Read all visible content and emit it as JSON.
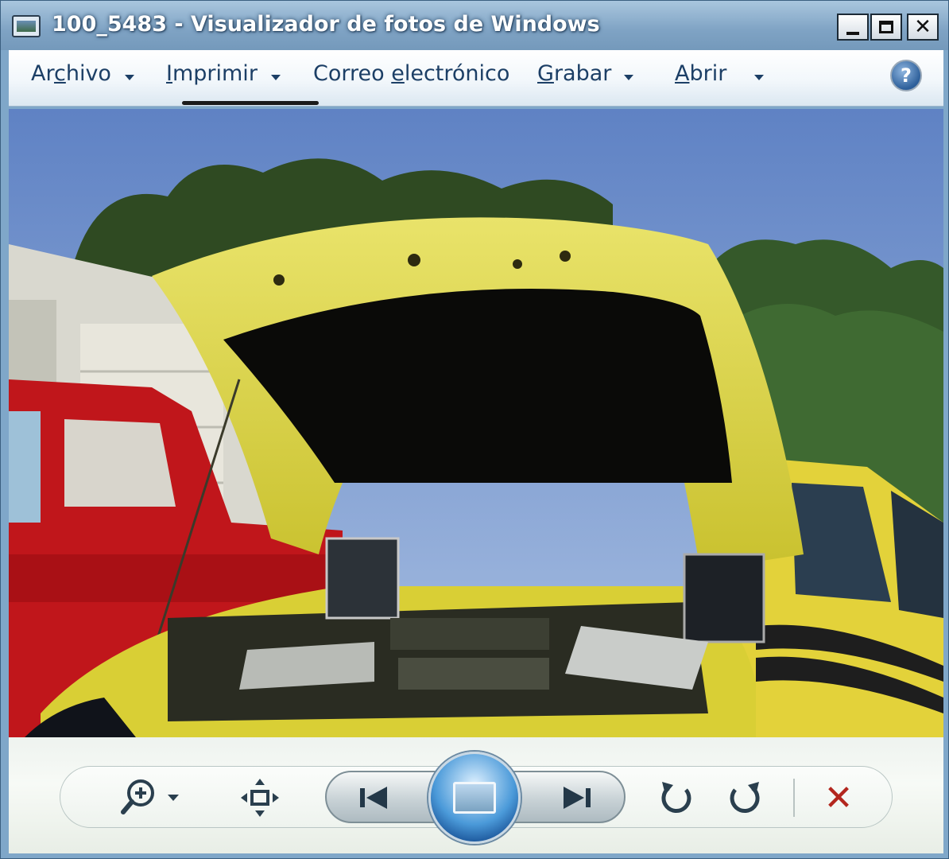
{
  "window": {
    "title": "100_5483 - Visualizador de fotos de Windows",
    "minimize_icon": "minimize-icon",
    "maximize_icon": "maximize-icon",
    "close_glyph": "✕"
  },
  "menu": {
    "items": [
      {
        "pre": "Ar",
        "ul": "c",
        "post": "hivo",
        "has_caret": true
      },
      {
        "pre": "",
        "ul": "I",
        "post": "mprimir",
        "has_caret": true
      },
      {
        "pre": "Correo ",
        "ul": "e",
        "post": "lectrónico",
        "has_caret": false
      },
      {
        "pre": "",
        "ul": "G",
        "post": "rabar",
        "has_caret": true
      },
      {
        "pre": "",
        "ul": "A",
        "post": "brir",
        "has_caret": true
      }
    ],
    "help_glyph": "?"
  },
  "photo": {
    "subject": "yellow car with open hood, red pickup truck, trees and sky"
  },
  "controls": {
    "zoom_icon": "zoom-icon",
    "fit_icon": "actual-size-icon",
    "previous_icon": "previous-icon",
    "slideshow_icon": "slideshow-icon",
    "next_icon": "next-icon",
    "rotate_ccw_icon": "rotate-counterclockwise-icon",
    "rotate_cw_icon": "rotate-clockwise-icon",
    "delete_glyph": "✕"
  },
  "colors": {
    "titlebar": "#7fa3c4",
    "menu_text": "#1c3f66",
    "delete_red": "#b3261e"
  }
}
